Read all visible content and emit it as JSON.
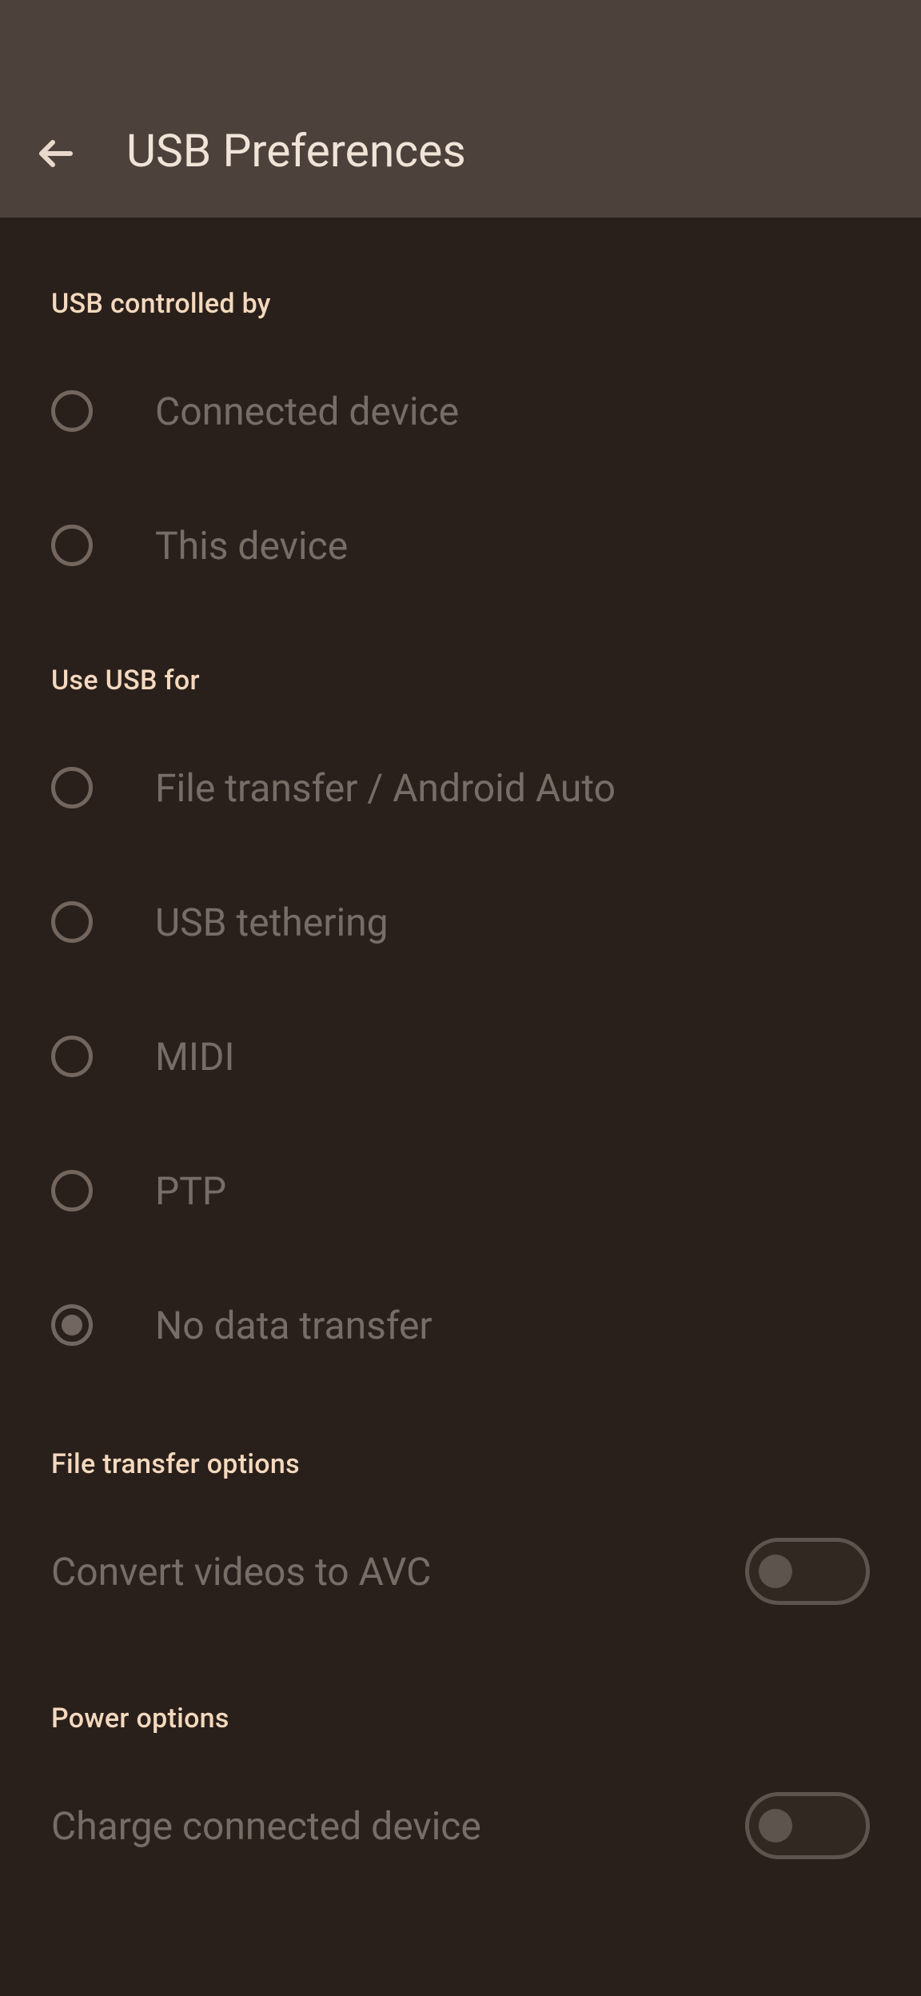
{
  "header": {
    "title": "USB Preferences"
  },
  "sections": {
    "controlled_by": {
      "header": "USB controlled by",
      "options": [
        {
          "label": "Connected device",
          "selected": false
        },
        {
          "label": "This device",
          "selected": false
        }
      ]
    },
    "use_for": {
      "header": "Use USB for",
      "options": [
        {
          "label": "File transfer / Android Auto",
          "selected": false
        },
        {
          "label": "USB tethering",
          "selected": false
        },
        {
          "label": "MIDI",
          "selected": false
        },
        {
          "label": "PTP",
          "selected": false
        },
        {
          "label": "No data transfer",
          "selected": true
        }
      ]
    },
    "file_transfer": {
      "header": "File transfer options",
      "switch": {
        "label": "Convert videos to AVC",
        "on": false
      }
    },
    "power": {
      "header": "Power options",
      "switch": {
        "label": "Charge connected device",
        "on": false
      }
    }
  }
}
